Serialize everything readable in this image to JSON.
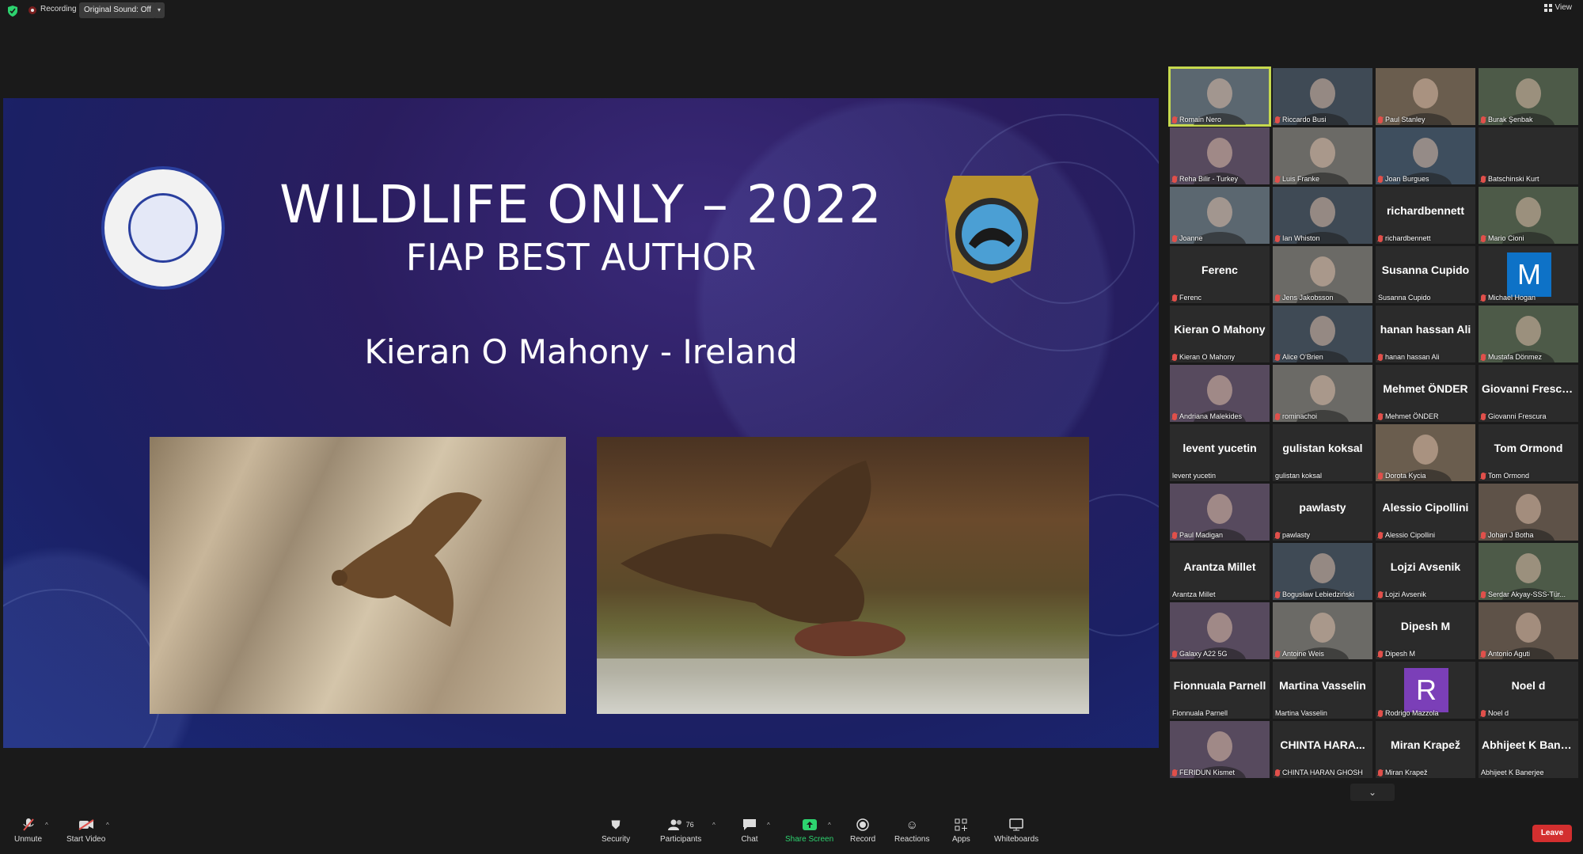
{
  "topbar": {
    "recording_label": "Recording",
    "original_sound": "Original Sound: Off",
    "view_label": "View"
  },
  "slide": {
    "title": "WILDLIFE ONLY – 2022",
    "subtitle": "FIAP BEST AUTHOR",
    "author": "Kieran O Mahony - Ireland"
  },
  "participants": [
    {
      "name": "Romain Nero",
      "big": "",
      "type": "video",
      "active": true
    },
    {
      "name": "Riccardo Busi",
      "big": "",
      "type": "video"
    },
    {
      "name": "Paul Stanley",
      "big": "",
      "type": "video"
    },
    {
      "name": "Burak Şenbak",
      "big": "",
      "type": "video"
    },
    {
      "name": "Reha Bilir - Turkey",
      "big": "",
      "type": "video"
    },
    {
      "name": "Luis Franke",
      "big": "",
      "type": "video"
    },
    {
      "name": "Joan Burgues",
      "big": "",
      "type": "video"
    },
    {
      "name": "Batschinski Kurt",
      "big": "",
      "type": "dark"
    },
    {
      "name": "Joanne",
      "big": "",
      "type": "video"
    },
    {
      "name": "Ian Whiston",
      "big": "",
      "type": "video"
    },
    {
      "name": "richardbennett",
      "big": "richardbennett",
      "type": "name"
    },
    {
      "name": "Mario Cioni",
      "big": "",
      "type": "video"
    },
    {
      "name": "Ferenc",
      "big": "Ferenc",
      "type": "name"
    },
    {
      "name": "Jens Jakobsson",
      "big": "",
      "type": "video"
    },
    {
      "name": "Susanna Cupido",
      "big": "Susanna Cupido",
      "type": "name",
      "nomic": true
    },
    {
      "name": "Michael Hogan",
      "big": "M",
      "type": "letter",
      "color": "#0e72c7"
    },
    {
      "name": "Kieran O Mahony",
      "big": "Kieran O Mahony",
      "type": "name"
    },
    {
      "name": "Alice O'Brien",
      "big": "",
      "type": "video"
    },
    {
      "name": "hanan hassan Ali",
      "big": "hanan hassan Ali",
      "type": "name"
    },
    {
      "name": "Mustafa Dönmez",
      "big": "",
      "type": "video"
    },
    {
      "name": "Andriana Malekides",
      "big": "",
      "type": "video"
    },
    {
      "name": "rominachoi",
      "big": "",
      "type": "video"
    },
    {
      "name": "Mehmet ÖNDER",
      "big": "Mehmet ÖNDER",
      "type": "name"
    },
    {
      "name": "Giovanni Frescura",
      "big": "Giovanni Frescura",
      "type": "name"
    },
    {
      "name": "levent yucetin",
      "big": "levent yucetin",
      "type": "name",
      "nomic": true
    },
    {
      "name": "gulistan koksal",
      "big": "gulistan koksal",
      "type": "name",
      "nomic": true
    },
    {
      "name": "Dorota Kycia",
      "big": "",
      "type": "video"
    },
    {
      "name": "Tom Ormond",
      "big": "Tom Ormond",
      "type": "name"
    },
    {
      "name": "Paul Madigan",
      "big": "",
      "type": "video"
    },
    {
      "name": "pawlasty",
      "big": "pawlasty",
      "type": "name"
    },
    {
      "name": "Alessio Cipollini",
      "big": "Alessio Cipollini",
      "type": "name"
    },
    {
      "name": "Johan J Botha",
      "big": "",
      "type": "video"
    },
    {
      "name": "Arantza Millet",
      "big": "Arantza Millet",
      "type": "name",
      "nomic": true
    },
    {
      "name": "Bogusław Lebiedziński",
      "big": "",
      "type": "video"
    },
    {
      "name": "Lojzi Avsenik",
      "big": "Lojzi Avsenik",
      "type": "name"
    },
    {
      "name": "Serdar Akyay-SSS-Tür...",
      "big": "",
      "type": "video"
    },
    {
      "name": "Galaxy A22 5G",
      "big": "",
      "type": "video"
    },
    {
      "name": "Antoine Weis",
      "big": "",
      "type": "video"
    },
    {
      "name": "Dipesh M",
      "big": "Dipesh M",
      "type": "name"
    },
    {
      "name": "Antonio Aguti",
      "big": "",
      "type": "video"
    },
    {
      "name": "Fionnuala Parnell",
      "big": "Fionnuala Parnell",
      "type": "name",
      "nomic": true
    },
    {
      "name": "Martina Vasselin",
      "big": "Martina Vasselin",
      "type": "name",
      "nomic": true
    },
    {
      "name": "Rodrigo Mazzola",
      "big": "R",
      "type": "letter",
      "color": "#7b3fb8"
    },
    {
      "name": "Noel d",
      "big": "Noel d",
      "type": "name"
    },
    {
      "name": "FERIDUN Kismet",
      "big": "",
      "type": "video"
    },
    {
      "name": "CHINTA HARAN GHOSH",
      "big": "CHINTA HARA...",
      "type": "name"
    },
    {
      "name": "Miran Krapež",
      "big": "Miran Krapež",
      "type": "name"
    },
    {
      "name": "Abhijeet K Banerjee",
      "big": "Abhijeet K Bane...",
      "type": "name",
      "nomic": true
    }
  ],
  "toolbar": {
    "unmute": "Unmute",
    "start_video": "Start Video",
    "security": "Security",
    "participants": "Participants",
    "participants_count": "76",
    "chat": "Chat",
    "share_screen": "Share Screen",
    "record": "Record",
    "reactions": "Reactions",
    "apps": "Apps",
    "whiteboards": "Whiteboards",
    "leave": "Leave"
  },
  "colors": {
    "active_border": "#c6d94e",
    "share_green": "#2dd36f",
    "leave_red": "#d32f2f",
    "muted_red": "#e0504b"
  }
}
